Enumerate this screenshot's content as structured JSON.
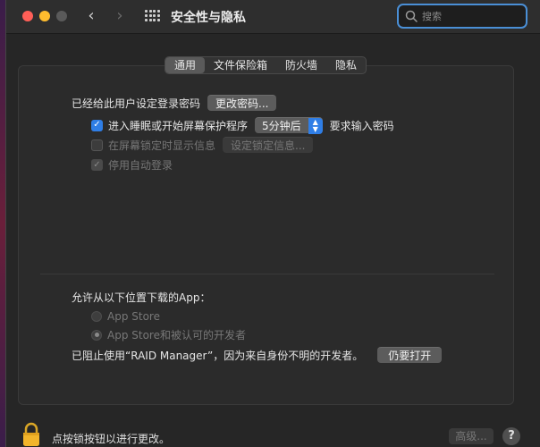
{
  "window": {
    "title": "安全性与隐私",
    "search_placeholder": "搜索"
  },
  "tabs": [
    {
      "label": "通用",
      "active": true
    },
    {
      "label": "文件保险箱",
      "active": false
    },
    {
      "label": "防火墙",
      "active": false
    },
    {
      "label": "隐私",
      "active": false
    }
  ],
  "general": {
    "password_set_label": "已经给此用户设定登录密码",
    "change_password_button": "更改密码...",
    "require_password": {
      "label": "进入睡眠或开始屏幕保护程序",
      "checked": true,
      "popup_value": "5分钟后",
      "suffix": "要求输入密码"
    },
    "show_message": {
      "label": "在屏幕锁定时显示信息",
      "checked": false,
      "button": "设定锁定信息..."
    },
    "disable_autologin": {
      "label": "停用自动登录",
      "checked": true
    }
  },
  "downloads": {
    "heading": "允许从以下位置下载的App：",
    "options": [
      {
        "label": "App Store",
        "selected": false
      },
      {
        "label": "App Store和被认可的开发者",
        "selected": true
      }
    ],
    "blocked_message": "已阻止使用“RAID Manager”，因为来自身份不明的开发者。",
    "open_anyway_button": "仍要打开"
  },
  "footer": {
    "lock_text": "点按锁按钮以进行更改。",
    "advanced_button": "高级...",
    "help_button": "?"
  },
  "colors": {
    "accent": "#2f7ee6",
    "search_focus": "#4a8fd6"
  }
}
